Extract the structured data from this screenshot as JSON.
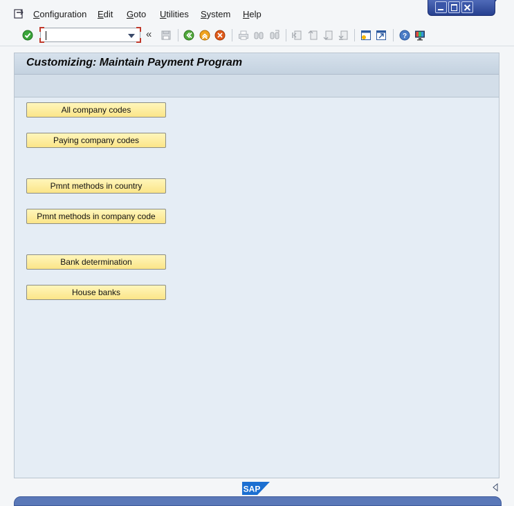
{
  "menu": {
    "items": [
      {
        "label": "Configuration"
      },
      {
        "label": "Edit"
      },
      {
        "label": "Goto"
      },
      {
        "label": "Utilities"
      },
      {
        "label": "System"
      },
      {
        "label": "Help"
      }
    ]
  },
  "toolbar": {
    "command_field_value": "",
    "icons": [
      "enter-icon",
      "save-icon",
      "back-icon",
      "exit-icon",
      "cancel-icon",
      "print-icon",
      "find-icon",
      "find-next-icon",
      "first-page-icon",
      "previous-page-icon",
      "next-page-icon",
      "last-page-icon",
      "create-session-icon",
      "shortcut-icon",
      "help-icon",
      "customize-layout-icon"
    ]
  },
  "page": {
    "title": "Customizing: Maintain Payment Program"
  },
  "buttons": [
    {
      "label": "All company codes"
    },
    {
      "label": "Paying company codes"
    },
    {
      "label": "Pmnt methods in country"
    },
    {
      "label": "Pmnt methods in company code"
    },
    {
      "label": "Bank determination"
    },
    {
      "label": "House banks"
    }
  ],
  "footer": {
    "logo": "SAP"
  }
}
